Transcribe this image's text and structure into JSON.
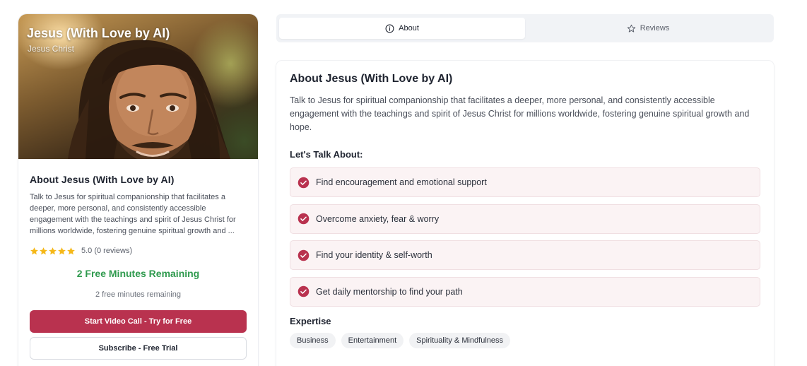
{
  "profile": {
    "title": "Jesus (With Love by AI)",
    "subtitle": "Jesus Christ",
    "heading": "About Jesus (With Love by AI)",
    "description": "Talk to Jesus for spiritual companionship that facilitates a deeper, more personal, and consistently accessible engagement with the teachings and spirit of Jesus Christ for millions worldwide, fostering genuine spiritual growth and ...",
    "rating_value": 5,
    "rating_text": "5.0 (0 reviews)",
    "free_minutes_title": "2 Free Minutes Remaining",
    "free_minutes_sub": "2 free minutes remaining",
    "primary_button": "Start Video Call - Try for Free",
    "secondary_button": "Subscribe - Free Trial"
  },
  "tabs": [
    {
      "label": "About",
      "icon": "info-icon",
      "active": true
    },
    {
      "label": "Reviews",
      "icon": "star-outline-icon",
      "active": false
    }
  ],
  "about": {
    "title": "About Jesus (With Love by AI)",
    "description": "Talk to Jesus for spiritual companionship that facilitates a deeper, more personal, and consistently accessible engagement with the teachings and spirit of Jesus Christ for millions worldwide, fostering genuine spiritual growth and hope.",
    "talk_heading": "Let's Talk About:",
    "topics": [
      "Find encouragement and emotional support",
      "Overcome anxiety, fear & worry",
      "Find your identity & self-worth",
      "Get daily mentorship to find your path"
    ],
    "expertise_heading": "Expertise",
    "expertise_tags": [
      "Business",
      "Entertainment",
      "Spirituality & Mindfulness"
    ]
  },
  "colors": {
    "accent": "#b9324f",
    "success": "#2f9a4e",
    "star": "#f5b819"
  }
}
